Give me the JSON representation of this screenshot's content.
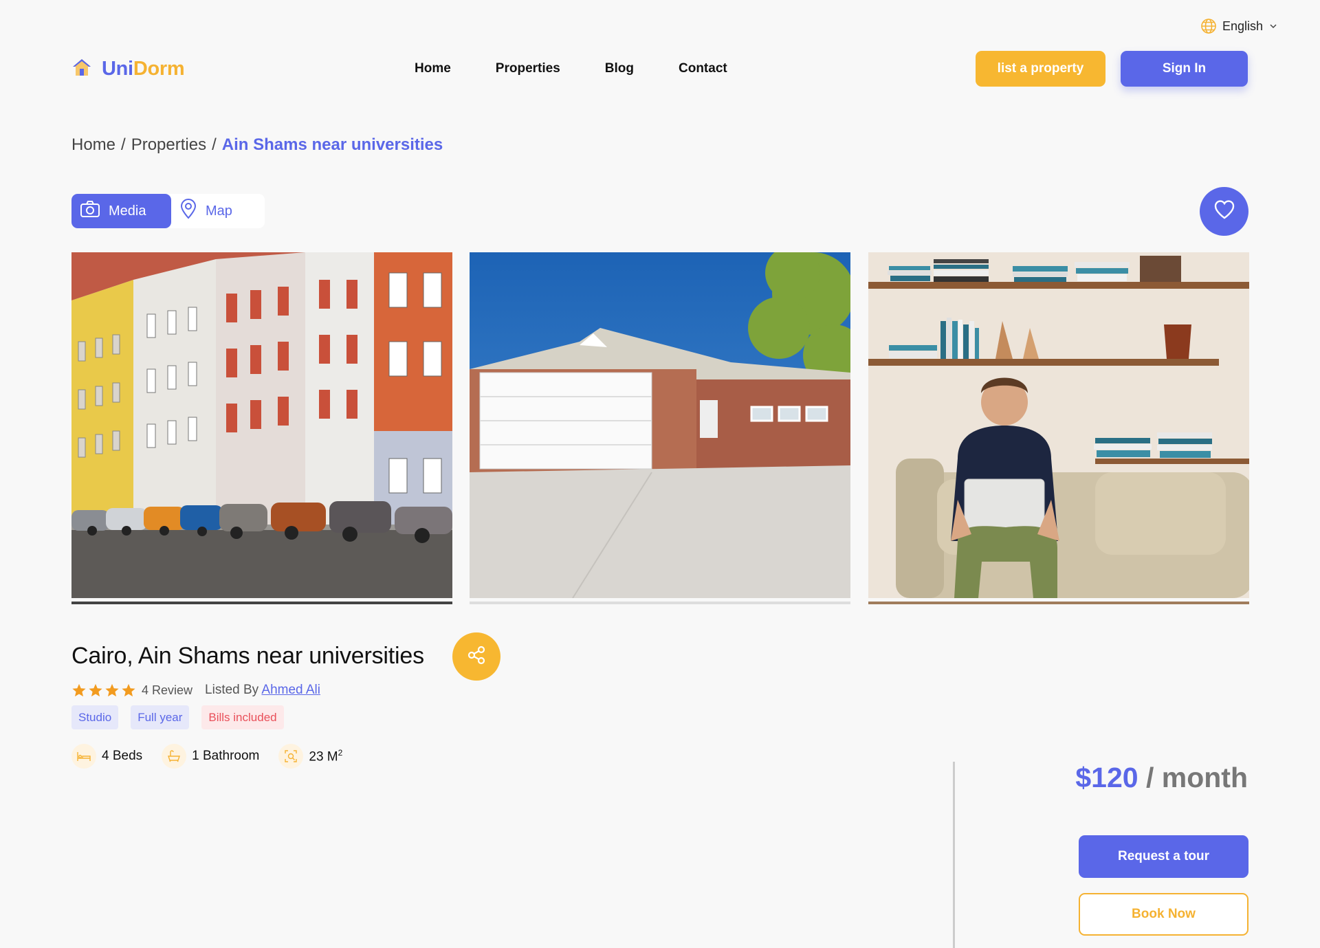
{
  "language": {
    "label": "English",
    "icon": "globe-icon"
  },
  "brand": {
    "name_part1": "Uni",
    "name_part2": "Dorm",
    "icon": "home-icon"
  },
  "nav": [
    "Home",
    "Properties",
    "Blog",
    "Contact"
  ],
  "header_buttons": {
    "list_property": "list a property",
    "sign_in": "Sign In"
  },
  "breadcrumb": {
    "items": [
      "Home",
      "Properties"
    ],
    "separator": "/",
    "current": "Ain Shams near universities"
  },
  "view_tabs": {
    "media": "Media",
    "map": "Map",
    "active": "Media"
  },
  "gallery": {
    "photos": [
      {
        "alt": "colorful row buildings with parked cars",
        "name": "photo-buildings"
      },
      {
        "alt": "single-story house with garage",
        "name": "photo-house"
      },
      {
        "alt": "man on sofa with laptop",
        "name": "photo-interior"
      }
    ]
  },
  "listing": {
    "title": "Cairo, Ain Shams near universities",
    "rating_stars": 4,
    "review_text": "4 Review",
    "listed_by_label": "Listed By",
    "owner": "Ahmed Ali",
    "badges": [
      {
        "label": "Studio",
        "tone": "blue"
      },
      {
        "label": "Full year",
        "tone": "blue"
      },
      {
        "label": "Bills included",
        "tone": "red"
      }
    ],
    "features": {
      "beds": "4 Beds",
      "bathroom": "1 Bathroom",
      "area": "23 M",
      "area_sup": "2"
    }
  },
  "pricing": {
    "amount": "$120",
    "period": " / month"
  },
  "actions": {
    "request_tour": "Request a tour",
    "book_now": "Book Now"
  },
  "colors": {
    "primary": "#5a67e8",
    "accent": "#f7b731",
    "danger": "#e9505a"
  }
}
